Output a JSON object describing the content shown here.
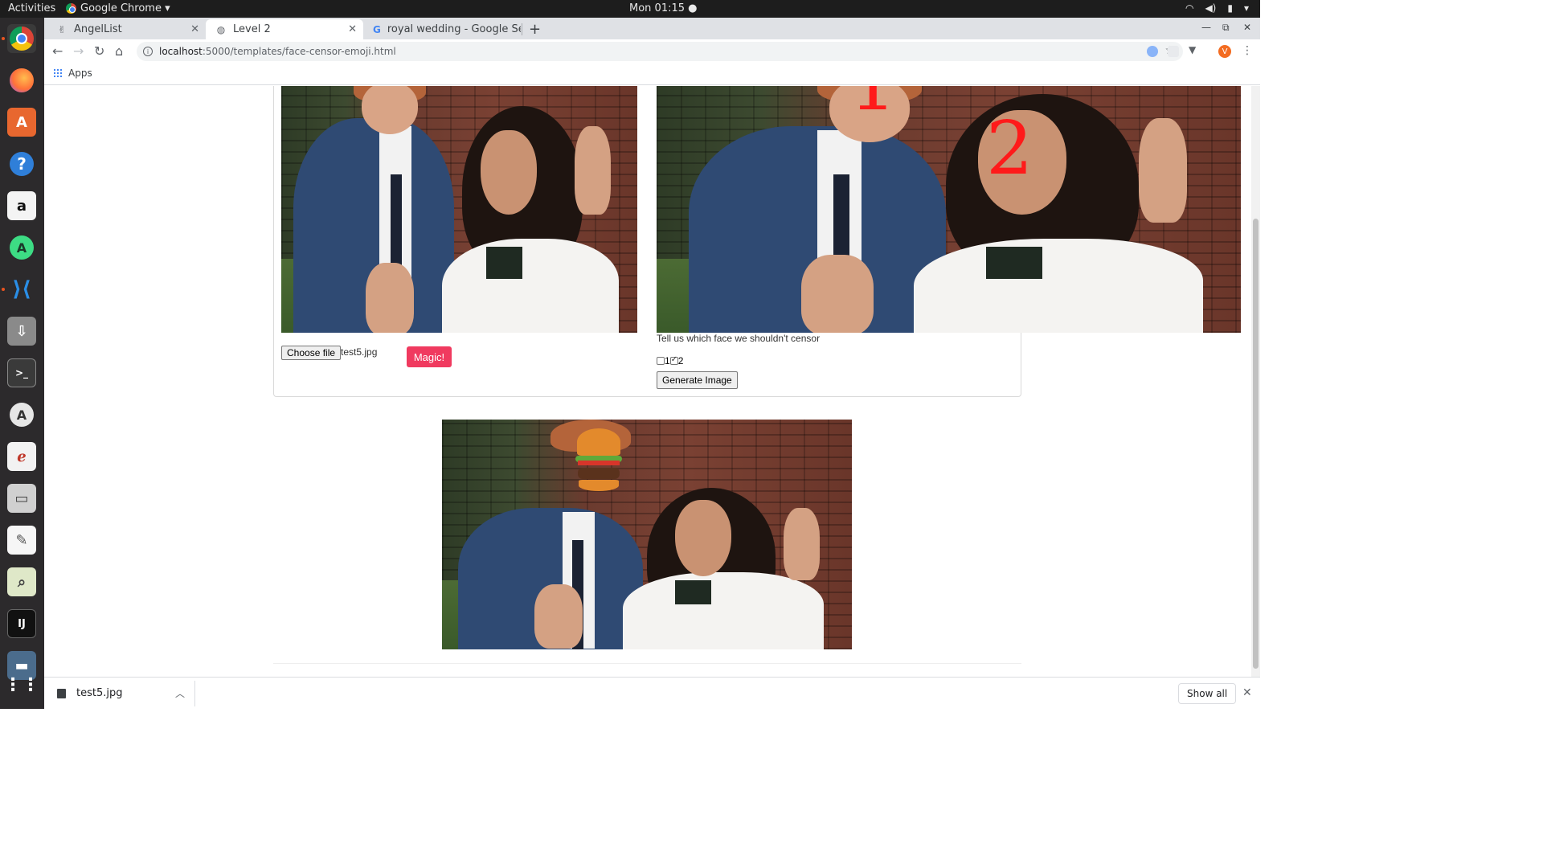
{
  "system": {
    "activities": "Activities",
    "app_menu": "Google Chrome ▾",
    "clock": "Mon 01:15 ●"
  },
  "tabs": [
    {
      "label": "AngelList",
      "icon": "angellist-icon"
    },
    {
      "label": "Level 2",
      "icon": "globe-icon"
    },
    {
      "label": "royal wedding - Google Se",
      "icon": "google-icon"
    }
  ],
  "toolbar": {
    "url_host": "localhost",
    "url_path": ":5000/templates/face-censor-emoji.html"
  },
  "bookmarks": {
    "apps_label": "Apps"
  },
  "page": {
    "face_labels": [
      "1",
      "2"
    ],
    "choose_file_label": "Choose file",
    "file_name": "test5.jpg",
    "magic_button_label": "Magic!",
    "censor_prompt": "Tell us which face we shouldn't censor",
    "checkbox_options": [
      {
        "label": "1",
        "checked": false
      },
      {
        "label": "2",
        "checked": true
      }
    ],
    "generate_button_label": "Generate Image",
    "censor_emoji": "burger-emoji"
  },
  "downloads": {
    "file_name": "test5.jpg",
    "show_all_label": "Show all"
  },
  "colors": {
    "accent_button": "#f03a5f",
    "face_number_red": "#ff1a1a",
    "topbar": "#1d1d1d",
    "dock": "#2c2a2c"
  }
}
